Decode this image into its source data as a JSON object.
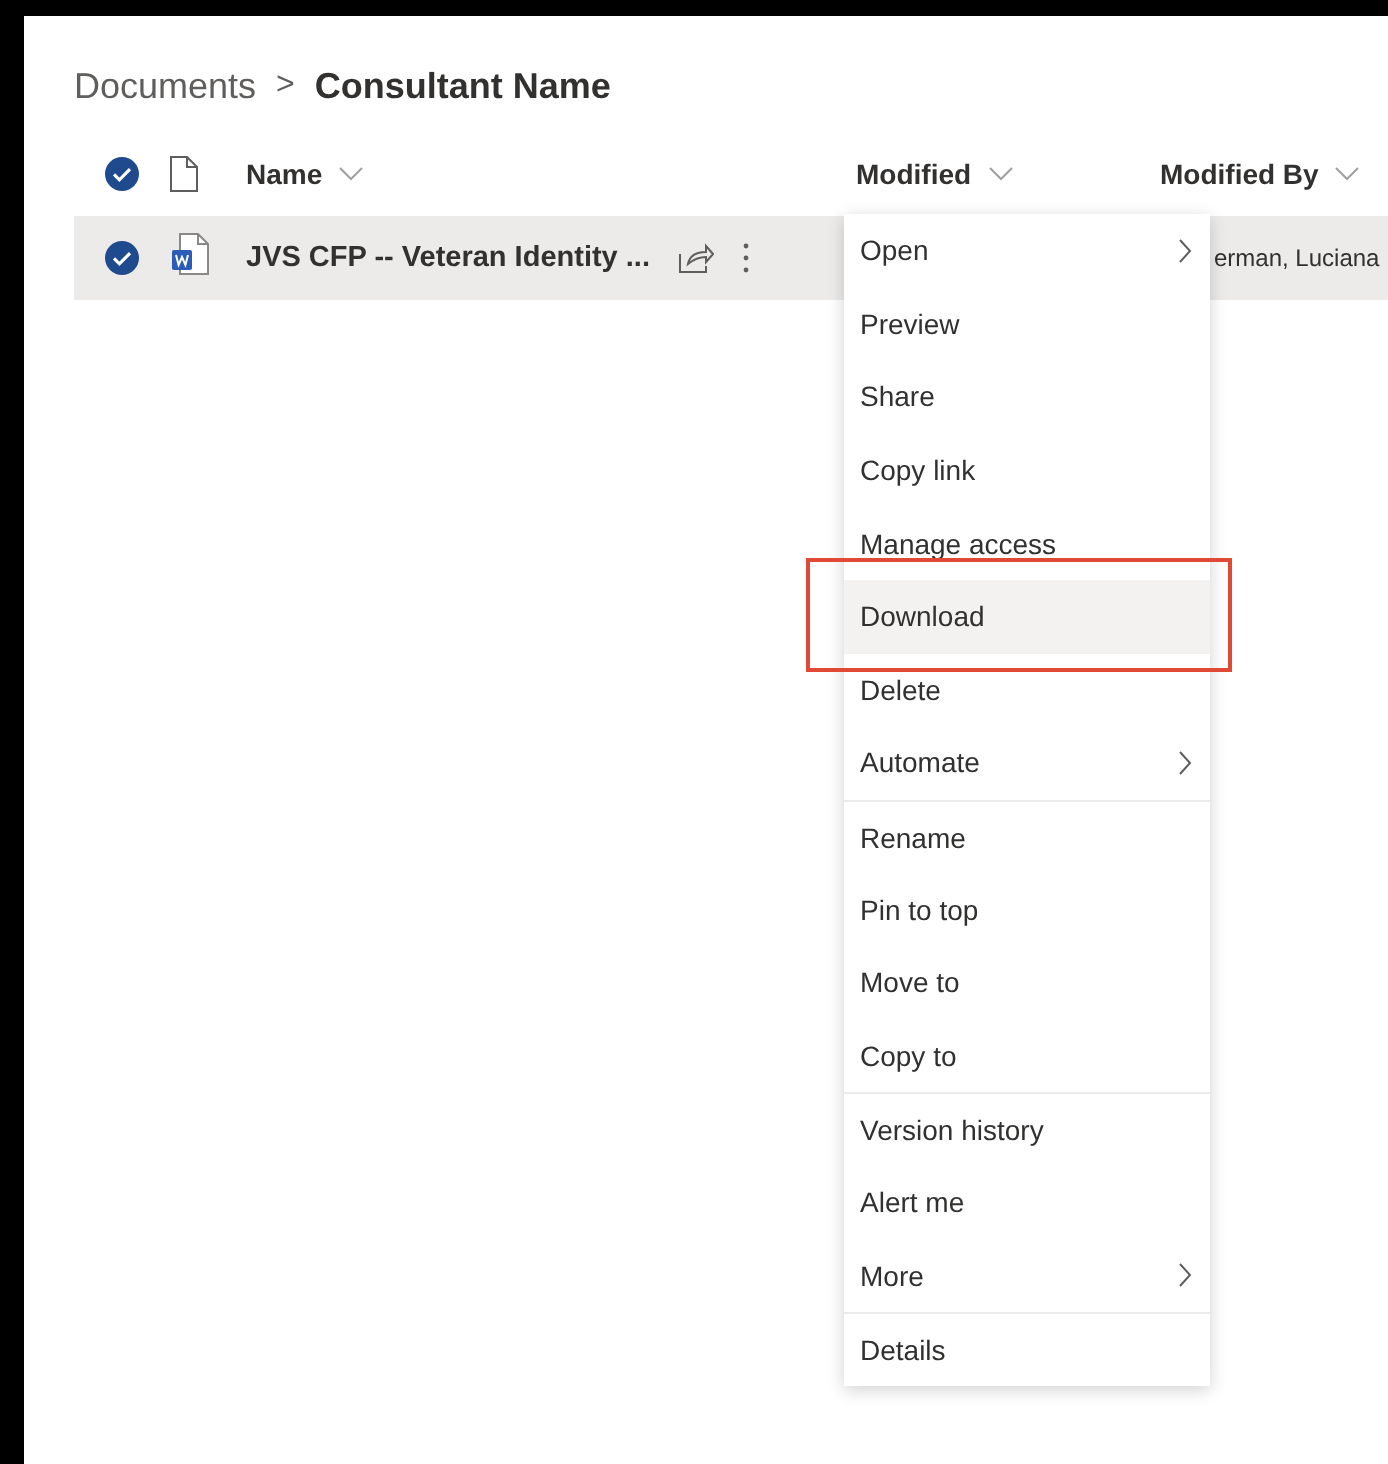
{
  "breadcrumb": {
    "parent": "Documents",
    "separator": ">",
    "current": "Consultant Name"
  },
  "columns": [
    {
      "label": "Name"
    },
    {
      "label": "Modified"
    },
    {
      "label": "Modified By"
    }
  ],
  "header_checkbox": {
    "checked": true
  },
  "rows": [
    {
      "name": "JVS CFP -- Veteran Identity ...",
      "modified_by": "erman, Luciana",
      "selected": true
    }
  ],
  "context_menu": {
    "items": [
      {
        "kind": "item",
        "label": "Open",
        "submenu": true,
        "hovered": false,
        "separator_before": false
      },
      {
        "kind": "item",
        "label": "Preview",
        "submenu": false,
        "hovered": false,
        "separator_before": false
      },
      {
        "kind": "item",
        "label": "Share",
        "submenu": false,
        "hovered": false,
        "separator_before": false
      },
      {
        "kind": "item",
        "label": "Copy link",
        "submenu": false,
        "hovered": false,
        "separator_before": false
      },
      {
        "kind": "item",
        "label": "Manage access",
        "submenu": false,
        "hovered": false,
        "separator_before": false
      },
      {
        "kind": "outline",
        "items": [
          {
            "kind": "item",
            "label": "Download",
            "submenu": false,
            "hovered": true,
            "separator_before": false
          }
        ]
      },
      {
        "kind": "item",
        "label": "Delete",
        "submenu": false,
        "hovered": false,
        "separator_before": false
      },
      {
        "kind": "item",
        "label": "Automate",
        "submenu": true,
        "hovered": false,
        "separator_before": false
      },
      {
        "kind": "item",
        "label": "Rename",
        "submenu": false,
        "hovered": false,
        "separator_before": true
      },
      {
        "kind": "item",
        "label": "Pin to top",
        "submenu": false,
        "hovered": false,
        "separator_before": false
      },
      {
        "kind": "item",
        "label": "Move to",
        "submenu": false,
        "hovered": false,
        "separator_before": false
      },
      {
        "kind": "item",
        "label": "Copy to",
        "submenu": false,
        "hovered": false,
        "separator_before": false
      },
      {
        "kind": "item",
        "label": "Version history",
        "submenu": false,
        "hovered": false,
        "separator_before": true
      },
      {
        "kind": "item",
        "label": "Alert me",
        "submenu": false,
        "hovered": false,
        "separator_before": false
      },
      {
        "kind": "item",
        "label": "More",
        "submenu": true,
        "hovered": false,
        "separator_before": false
      },
      {
        "kind": "item",
        "label": "Details",
        "submenu": false,
        "hovered": false,
        "separator_before": true
      }
    ]
  }
}
